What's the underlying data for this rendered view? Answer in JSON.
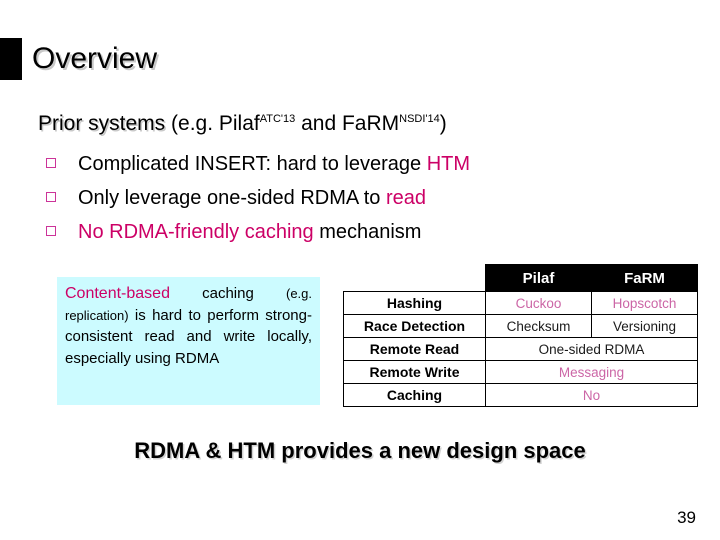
{
  "slide": {
    "title": "Overview",
    "page_number": "39",
    "accent_color": "#cc0066",
    "bullet_color": "#cc3399",
    "callout_bg": "#ccfbff",
    "table_value_color": "#cc66a6"
  },
  "lead": {
    "emphasis": "Prior systems",
    "rest_before": " (e.g. Pilaf",
    "sup1": "ATC'13",
    "middle": " and FaRM",
    "sup2": "NSDI'14",
    "rest_after": ")"
  },
  "bullets": [
    {
      "plain_a": "Complicated INSERT: hard to leverage ",
      "highlight": "HTM",
      "plain_b": ""
    },
    {
      "plain_a": "Only leverage one-sided RDMA to ",
      "highlight": "read",
      "plain_b": ""
    },
    {
      "plain_a": "",
      "highlight": "No RDMA-friendly caching",
      "plain_b": " mechanism"
    }
  ],
  "callout": {
    "lead_term": "Content-based",
    "part1": " caching ",
    "small_note": "(e.g. replication)",
    "part2": " is hard to perform strong-consistent read and write locally, especially using RDMA"
  },
  "table": {
    "columns": [
      "",
      "Pilaf",
      "FaRM"
    ],
    "rows": [
      {
        "label": "Hashing",
        "cells": [
          "Cuckoo",
          "Hopscotch"
        ],
        "span": false,
        "style": [
          "pink",
          "pink"
        ]
      },
      {
        "label": "Race Detection",
        "cells": [
          "Checksum",
          "Versioning"
        ],
        "span": false,
        "style": [
          "dark",
          "dark"
        ]
      },
      {
        "label": "Remote Read",
        "cells": [
          "One-sided RDMA"
        ],
        "span": true,
        "style": [
          "dark"
        ]
      },
      {
        "label": "Remote Write",
        "cells": [
          "Messaging"
        ],
        "span": true,
        "style": [
          "pink"
        ]
      },
      {
        "label": "Caching",
        "cells": [
          "No"
        ],
        "span": true,
        "style": [
          "pink"
        ]
      }
    ]
  },
  "conclusion": "RDMA & HTM provides a new design space"
}
